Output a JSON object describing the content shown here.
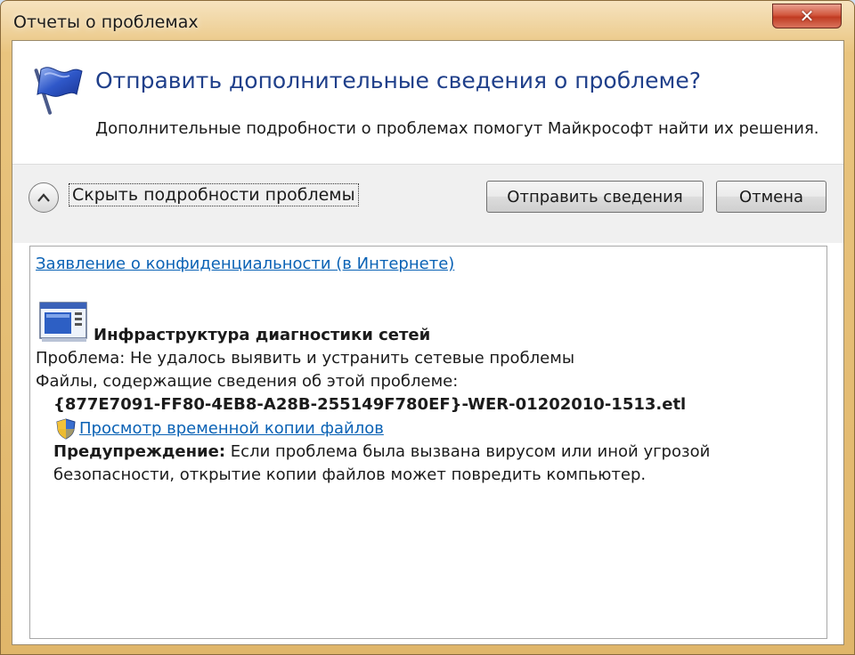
{
  "window": {
    "title": "Отчеты о проблемах",
    "close_glyph": "✕"
  },
  "header": {
    "heading": "Отправить дополнительные сведения о проблеме?",
    "subtext": "Дополнительные подробности о проблемах помогут Майкрософт найти их решения.",
    "icon": "flag-icon"
  },
  "toolbar": {
    "toggle_label": "Скрыть подробности проблемы",
    "toggle_glyph": "^",
    "send_label": "Отправить сведения",
    "cancel_label": "Отмена"
  },
  "details": {
    "privacy_link": "Заявление о конфиденциальности (в Интернете)",
    "app_name": "Инфраструктура диагностики сетей",
    "problem_line": "Проблема: Не удалось выявить и устранить сетевые проблемы",
    "files_line": "Файлы, содержащие сведения об этой проблеме:",
    "file_name": "{877E7091-FF80-4EB8-A28B-255149F780EF}-WER-01202010-1513.etl",
    "view_link": "Просмотр временной копии файлов",
    "warning_label": "Предупреждение:",
    "warning_text": " Если проблема была вызвана вирусом или иной угрозой",
    "warning_text2": "безопасности, открытие копии файлов может повредить компьютер."
  },
  "colors": {
    "heading": "#1f3f8a",
    "link": "#0a62b5",
    "frame": "#e0b66a"
  }
}
